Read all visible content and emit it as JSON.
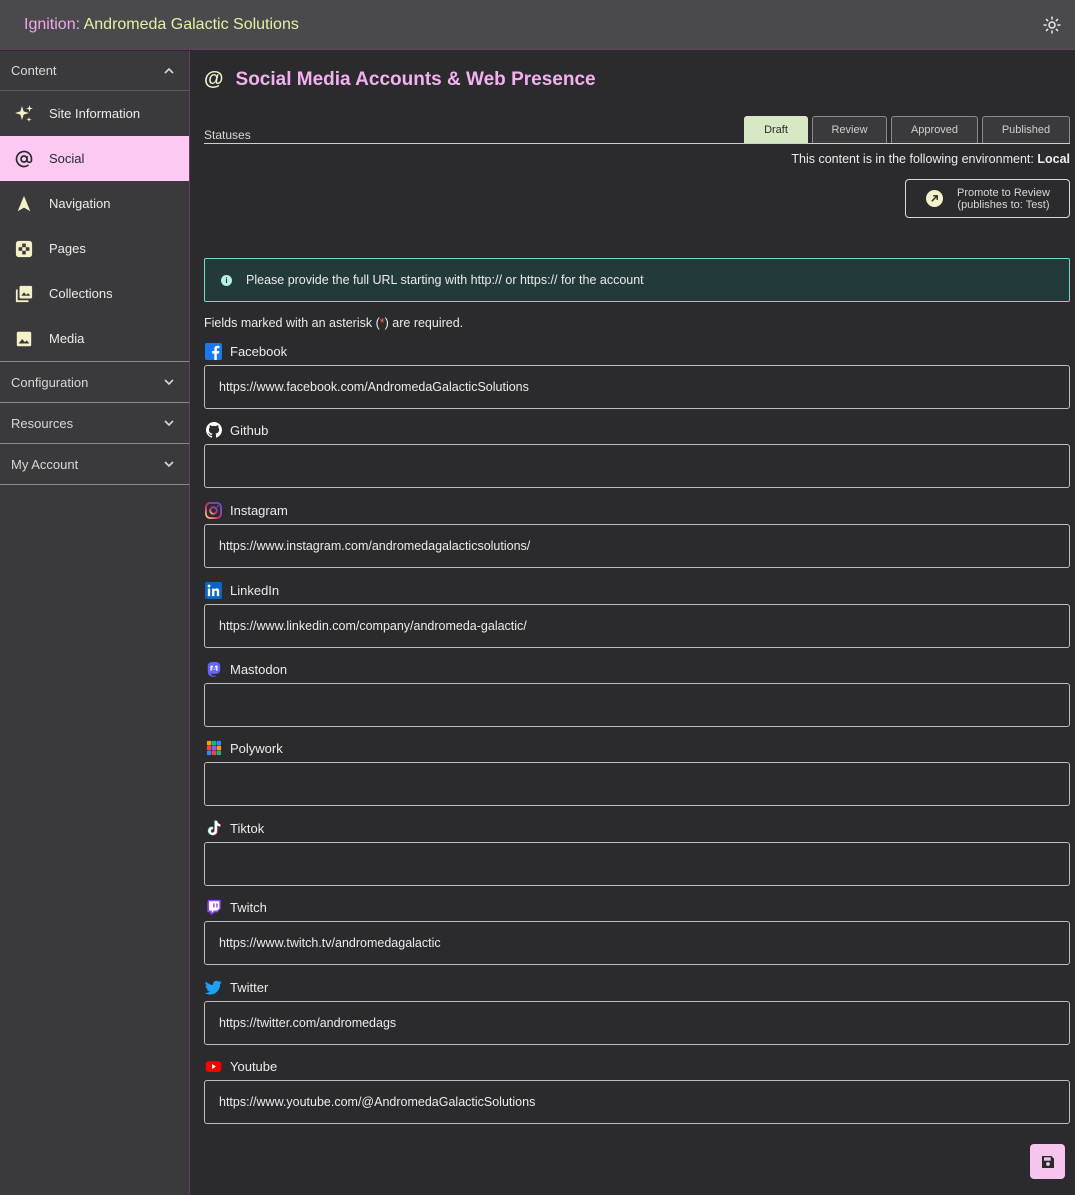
{
  "app": {
    "title_prefix": "Ignition:",
    "title_name": "Andromeda Galactic Solutions"
  },
  "sidebar": {
    "content_section": "Content",
    "items": [
      {
        "label": "Site Information",
        "icon": "sparkle-icon"
      },
      {
        "label": "Social",
        "icon": "at-sign-icon"
      },
      {
        "label": "Navigation",
        "icon": "navigation-arrow-icon"
      },
      {
        "label": "Pages",
        "icon": "pages-icon"
      },
      {
        "label": "Collections",
        "icon": "collections-icon"
      },
      {
        "label": "Media",
        "icon": "image-icon"
      }
    ],
    "configuration_section": "Configuration",
    "resources_section": "Resources",
    "account_section": "My Account",
    "active_item": "Social"
  },
  "page": {
    "title": "Social Media Accounts & Web Presence",
    "statuses_label": "Statuses",
    "tabs": [
      "Draft",
      "Review",
      "Approved",
      "Published"
    ],
    "active_tab": "Draft",
    "env_text": "This content is in the following environment:",
    "env_name": "Local",
    "promote_line1": "Promote to Review",
    "promote_line2": "(publishes to: Test)",
    "info_text": "Please provide the full URL starting with http:// or https:// for the account",
    "required_prefix": "Fields marked with an asterisk (",
    "required_asterisk": "*",
    "required_suffix": ") are required."
  },
  "fields": [
    {
      "label": "Facebook",
      "value": "https://www.facebook.com/AndromedaGalacticSolutions",
      "icon": "facebook-icon",
      "color": "#1877f2"
    },
    {
      "label": "Github",
      "value": "",
      "icon": "github-icon",
      "color": "#ffffff"
    },
    {
      "label": "Instagram",
      "value": "https://www.instagram.com/andromedagalacticsolutions/",
      "icon": "instagram-icon",
      "color": "#e1306c"
    },
    {
      "label": "LinkedIn",
      "value": "https://www.linkedin.com/company/andromeda-galactic/",
      "icon": "linkedin-icon",
      "color": "#0a66c2"
    },
    {
      "label": "Mastodon",
      "value": "",
      "icon": "mastodon-icon",
      "color": "#6364ff"
    },
    {
      "label": "Polywork",
      "value": "",
      "icon": "polywork-icon",
      "color": "#f59e0b"
    },
    {
      "label": "Tiktok",
      "value": "",
      "icon": "tiktok-icon",
      "color": "#ffffff"
    },
    {
      "label": "Twitch",
      "value": "https://www.twitch.tv/andromedagalactic",
      "icon": "twitch-icon",
      "color": "#9146ff"
    },
    {
      "label": "Twitter",
      "value": "https://twitter.com/andromedags",
      "icon": "twitter-icon",
      "color": "#1da1f2"
    },
    {
      "label": "Youtube",
      "value": "https://www.youtube.com/@AndromedaGalacticSolutions",
      "icon": "youtube-icon",
      "color": "#ff0000"
    }
  ]
}
